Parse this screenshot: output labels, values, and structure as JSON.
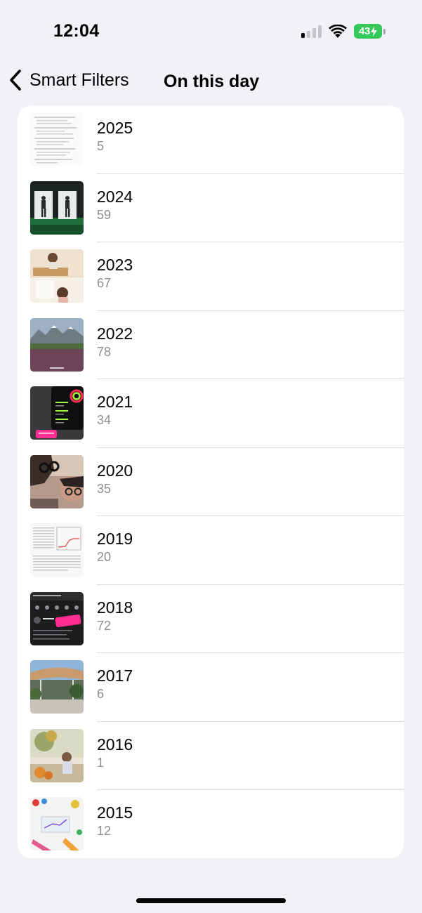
{
  "status_bar": {
    "time": "12:04",
    "battery_level": "43",
    "signal_bars_active": 1,
    "signal_bars_total": 4,
    "icons": [
      "cellular-signal-icon",
      "wifi-icon",
      "battery-charging-icon"
    ]
  },
  "nav": {
    "back_label": "Smart Filters",
    "back_icon": "chevron-left-icon",
    "title": "On this day"
  },
  "colors": {
    "background": "#f2f1f6",
    "card": "#ffffff",
    "secondary_text": "#8e8e93",
    "battery": "#34c759"
  },
  "rows": [
    {
      "year": "2025",
      "count": "5",
      "thumb": "document-thumbnail"
    },
    {
      "year": "2024",
      "count": "59",
      "thumb": "golf-swing-video-thumbnail"
    },
    {
      "year": "2023",
      "count": "67",
      "thumb": "child-photo-thumbnail"
    },
    {
      "year": "2022",
      "count": "78",
      "thumb": "mountain-landscape-thumbnail"
    },
    {
      "year": "2021",
      "count": "34",
      "thumb": "fitness-app-screenshot-thumbnail"
    },
    {
      "year": "2020",
      "count": "35",
      "thumb": "family-selfie-thumbnail"
    },
    {
      "year": "2019",
      "count": "20",
      "thumb": "paper-document-thumbnail"
    },
    {
      "year": "2018",
      "count": "72",
      "thumb": "app-screenshot-thumbnail"
    },
    {
      "year": "2017",
      "count": "6",
      "thumb": "building-architecture-thumbnail"
    },
    {
      "year": "2016",
      "count": "1",
      "thumb": "illustration-thumbnail"
    },
    {
      "year": "2015",
      "count": "12",
      "thumb": "craft-table-thumbnail"
    }
  ]
}
